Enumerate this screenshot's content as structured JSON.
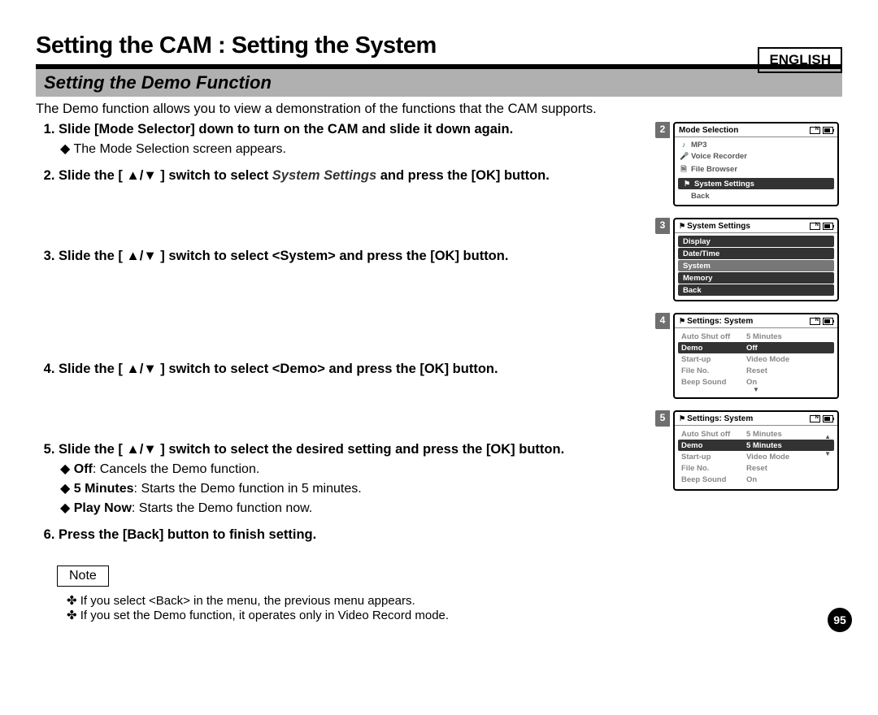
{
  "language": "ENGLISH",
  "title": "Setting the CAM : Setting the System",
  "subtitle": "Setting the Demo Function",
  "intro": "The Demo function allows you to view a demonstration of the functions that the CAM supports.",
  "steps": {
    "s1": {
      "text": "Slide [Mode Selector] down to turn on the CAM and slide it down again.",
      "sub": "The Mode Selection screen appears."
    },
    "s2": {
      "pre": "Slide the [ ▲/▼ ] switch to select ",
      "italic": "System Settings",
      "post": " and press the [OK] button."
    },
    "s3": "Slide the [ ▲/▼ ] switch to select <System> and press the [OK] button.",
    "s4": "Slide the [ ▲/▼ ] switch to select <Demo> and press the [OK] button.",
    "s5": {
      "text": "Slide the [ ▲/▼ ] switch to select the desired setting and press the [OK] button.",
      "subs": [
        {
          "b": "Off",
          "t": ": Cancels the Demo function."
        },
        {
          "b": "5 Minutes",
          "t": ": Starts the Demo function in 5 minutes."
        },
        {
          "b": "Play Now",
          "t": ": Starts the Demo function now."
        }
      ]
    },
    "s6": "Press the [Back] button to finish setting."
  },
  "note_label": "Note",
  "notes": [
    "If you select <Back> in the menu, the previous menu appears.",
    "If you set the Demo function, it operates only in Video Record mode."
  ],
  "page_number": "95",
  "screens": {
    "s2": {
      "num": "2",
      "title": "Mode Selection",
      "rows": [
        {
          "icon": "♪",
          "label": "MP3"
        },
        {
          "icon": "🎤",
          "label": "Voice Recorder"
        },
        {
          "icon": "🗎",
          "label": "File Browser"
        },
        {
          "icon": "⚑",
          "label": "System Settings",
          "hl": true
        },
        {
          "icon": "",
          "label": "Back"
        }
      ]
    },
    "s3": {
      "num": "3",
      "title": "System Settings",
      "rows": [
        {
          "label": "Display"
        },
        {
          "label": "Date/Time"
        },
        {
          "label": "System",
          "sel": true
        },
        {
          "label": "Memory"
        },
        {
          "label": "Back"
        }
      ]
    },
    "s4": {
      "num": "4",
      "title": "Settings: System",
      "kv": [
        {
          "k": "Auto Shut off",
          "v": "5 Minutes"
        },
        {
          "k": "Demo",
          "v": "Off",
          "hl": true
        },
        {
          "k": "Start-up",
          "v": "Video Mode"
        },
        {
          "k": "File No.",
          "v": "Reset"
        },
        {
          "k": "Beep Sound",
          "v": "On"
        }
      ]
    },
    "s5": {
      "num": "5",
      "title": "Settings: System",
      "kv": [
        {
          "k": "Auto Shut off",
          "v": "5 Minutes"
        },
        {
          "k": "Demo",
          "v": "5 Minutes",
          "hl": true,
          "arrows": true
        },
        {
          "k": "Start-up",
          "v": "Video Mode"
        },
        {
          "k": "File No.",
          "v": "Reset"
        },
        {
          "k": "Beep Sound",
          "v": "On"
        }
      ]
    }
  }
}
